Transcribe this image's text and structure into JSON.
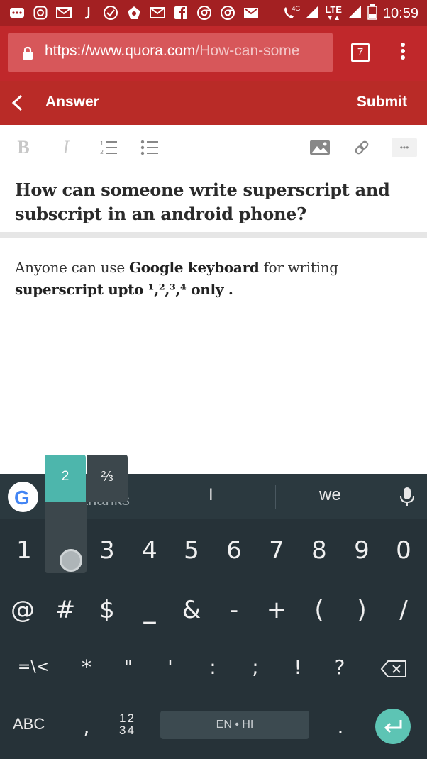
{
  "status_bar": {
    "time": "10:59",
    "network_label": "LTE",
    "network_sub": "4G"
  },
  "browser": {
    "url_host": "https://www.quora.com",
    "url_path": "/How-can-some",
    "tab_count": "7"
  },
  "header": {
    "title": "Answer",
    "submit_label": "Submit"
  },
  "toolbar": {
    "bold_label": "B",
    "italic_label": "I",
    "more_label": "•••"
  },
  "question": {
    "title": "How can someone write superscript and subscript in an android phone?"
  },
  "answer": {
    "text_1": "Anyone can use ",
    "bold_1": "Google keyboard",
    "text_2": " for writing ",
    "bold_2": "superscript upto ¹,²,³,⁴ only ."
  },
  "keyboard": {
    "suggestions": [
      "I",
      "we"
    ],
    "suggestion_partial": "thanks",
    "number_row": [
      "1",
      "2",
      "3",
      "4",
      "5",
      "6",
      "7",
      "8",
      "9",
      "0"
    ],
    "symbol_row": [
      "@",
      "#",
      "$",
      "_",
      "&",
      "-",
      "+",
      "(",
      ")",
      "/"
    ],
    "symbol_row2": [
      "=\\<",
      "*",
      "\"",
      "'",
      ":",
      ";",
      "!",
      "?"
    ],
    "abc_label": "ABC",
    "comma_label": ",",
    "digits_label_top": "12",
    "digits_label_bottom": "34",
    "space_label": "EN • HI",
    "period_label": ".",
    "popup_selected": "2",
    "popup_option": "⅔"
  }
}
